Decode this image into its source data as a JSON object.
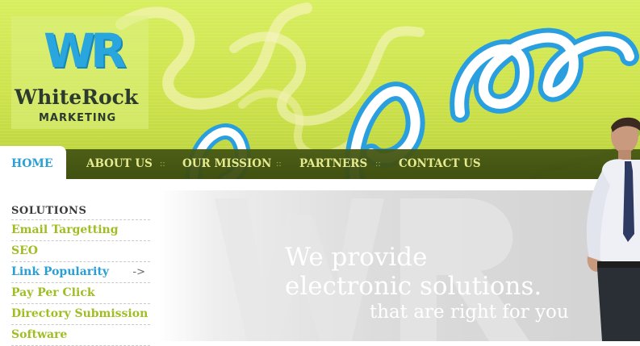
{
  "logo": {
    "mark": "WR",
    "name": "WhiteRock",
    "sub": "MARKETING"
  },
  "nav": {
    "items": [
      "HOME",
      "ABOUT US",
      "OUR MISSION",
      "PARTNERS",
      "CONTACT US"
    ],
    "separator": "::",
    "active": "HOME"
  },
  "sidebar": {
    "heading": "SOLUTIONS",
    "items": [
      {
        "label": "Email Targetting"
      },
      {
        "label": "SEO"
      },
      {
        "label": "Link Popularity",
        "arrow": "->"
      },
      {
        "label": "Pay Per Click"
      },
      {
        "label": "Directory Submission"
      },
      {
        "label": "Software"
      }
    ]
  },
  "banner": {
    "line1": "We provide",
    "line2": "electronic solutions.",
    "line3": "that are right for you"
  },
  "colors": {
    "header_green": "#cde24a",
    "nav_bg": "#3d4d12",
    "nav_text": "#e6ea8f",
    "accent_blue": "#2aa0d4",
    "sidebar_link": "#9fbe22"
  },
  "icons": {
    "sidebar_arrow": "arrow-right-icon"
  }
}
